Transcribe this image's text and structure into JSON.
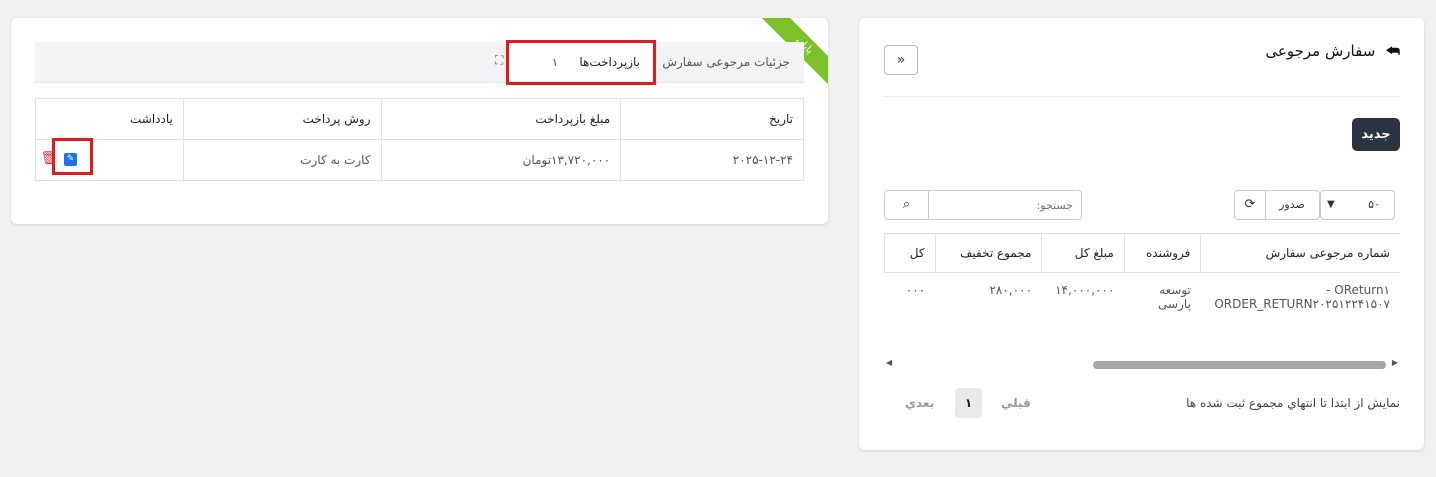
{
  "details_card": {
    "ribbon": "پایان",
    "tabs": {
      "details_label": "جزئیات مرجوعی سفارش",
      "refunds_label": "بازپرداخت‌ها",
      "refunds_count": "۱"
    },
    "expand_icon": "expand-icon",
    "table": {
      "headers": [
        "تاریخ",
        "مبلغ بازپرداخت",
        "روش پرداخت",
        "یادداشت"
      ],
      "rows": [
        {
          "date": "۲۰۲۵-۱۲-۲۴",
          "amount": "۱۳,۷۲۰,۰۰۰تومان",
          "method": "کارت به کارت",
          "note": ""
        }
      ]
    },
    "highlight_color": "#e11b22"
  },
  "orders_card": {
    "title": "سفارش مرجوعی",
    "back_icon": "reply-icon",
    "collapse_icon": "double-chevron-right-icon",
    "new_button": "جدید",
    "search_placeholder": "جستجو:",
    "export_label": "صدور",
    "page_size": "۵۰",
    "table": {
      "headers": [
        "شماره مرجوعی سفارش",
        "فروشنده",
        "مبلغ کل",
        "مجموع تخفیف",
        "کل"
      ],
      "rows": [
        {
          "number_line1": "OReturn۱ -",
          "number_line2": "ORDER_RETURN۲۰۲۵۱۲۲۴۱۵۰۷",
          "seller_line1": "توسعه",
          "seller_line2": "پارسی",
          "total": "۱۴,۰۰۰,۰۰۰",
          "discount": "۲۸۰,۰۰۰",
          "more": "۰۰۰"
        }
      ]
    },
    "footer_info": "نمایش از ابتدا تا انتهاي مجموع ثبت شده ها",
    "pagination": {
      "prev": "قبلي",
      "page": "۱",
      "next": "بعدي"
    }
  }
}
